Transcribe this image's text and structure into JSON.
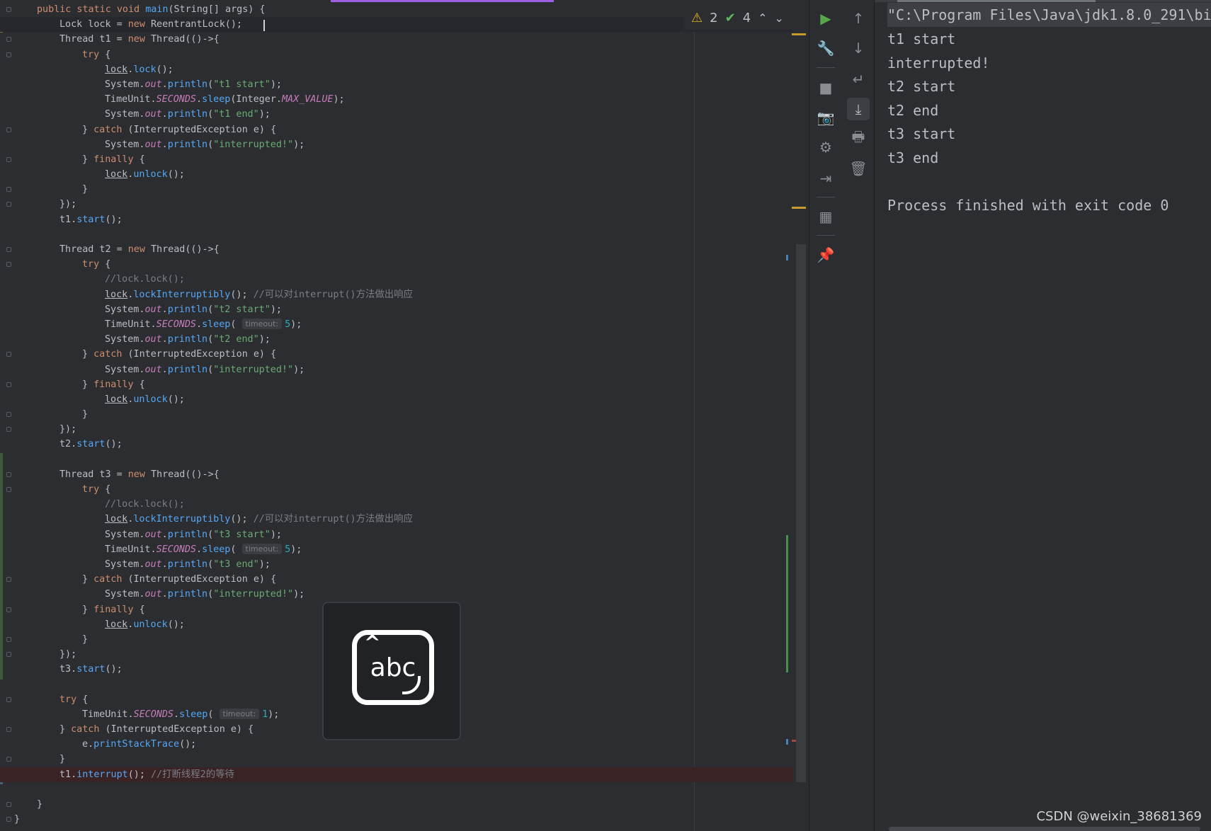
{
  "editor": {
    "lines": [
      {
        "indent": 1,
        "tokens": [
          [
            "kw",
            "public static void "
          ],
          [
            "fn",
            "main"
          ],
          [
            "p",
            "(String[] args) {"
          ]
        ]
      },
      {
        "indent": 2,
        "current": true,
        "tokens": [
          [
            "p",
            "Lock lock = "
          ],
          [
            "kw",
            "new "
          ],
          [
            "p",
            "ReentrantLock();"
          ]
        ]
      },
      {
        "indent": 2,
        "tokens": [
          [
            "p",
            "Thread t1 = "
          ],
          [
            "kw",
            "new "
          ],
          [
            "p",
            "Thread(()->{"
          ]
        ]
      },
      {
        "indent": 3,
        "tokens": [
          [
            "kw",
            "try "
          ],
          [
            "p",
            "{"
          ]
        ]
      },
      {
        "indent": 4,
        "tokens": [
          [
            "local",
            "lock"
          ],
          [
            "p",
            "."
          ],
          [
            "fn",
            "lock"
          ],
          [
            "p",
            "();"
          ]
        ]
      },
      {
        "indent": 4,
        "tokens": [
          [
            "p",
            "System."
          ],
          [
            "fld",
            "out"
          ],
          [
            "p",
            "."
          ],
          [
            "fn",
            "println"
          ],
          [
            "p",
            "("
          ],
          [
            "str",
            "\"t1 start\""
          ],
          [
            "p",
            ");"
          ]
        ]
      },
      {
        "indent": 4,
        "tokens": [
          [
            "p",
            "TimeUnit."
          ],
          [
            "const",
            "SECONDS"
          ],
          [
            "p",
            "."
          ],
          [
            "fn",
            "sleep"
          ],
          [
            "p",
            "(Integer."
          ],
          [
            "const",
            "MAX_VALUE"
          ],
          [
            "p",
            ");"
          ]
        ]
      },
      {
        "indent": 4,
        "tokens": [
          [
            "p",
            "System."
          ],
          [
            "fld",
            "out"
          ],
          [
            "p",
            "."
          ],
          [
            "fn",
            "println"
          ],
          [
            "p",
            "("
          ],
          [
            "str",
            "\"t1 end\""
          ],
          [
            "p",
            ");"
          ]
        ]
      },
      {
        "indent": 3,
        "tokens": [
          [
            "p",
            "} "
          ],
          [
            "kw",
            "catch "
          ],
          [
            "p",
            "(InterruptedException e) {"
          ]
        ]
      },
      {
        "indent": 4,
        "tokens": [
          [
            "p",
            "System."
          ],
          [
            "fld",
            "out"
          ],
          [
            "p",
            "."
          ],
          [
            "fn",
            "println"
          ],
          [
            "p",
            "("
          ],
          [
            "str",
            "\"interrupted!\""
          ],
          [
            "p",
            ");"
          ]
        ]
      },
      {
        "indent": 3,
        "tokens": [
          [
            "p",
            "} "
          ],
          [
            "kw",
            "finally "
          ],
          [
            "p",
            "{"
          ]
        ]
      },
      {
        "indent": 4,
        "tokens": [
          [
            "local",
            "lock"
          ],
          [
            "p",
            "."
          ],
          [
            "fn",
            "unlock"
          ],
          [
            "p",
            "();"
          ]
        ]
      },
      {
        "indent": 3,
        "tokens": [
          [
            "p",
            "}"
          ]
        ]
      },
      {
        "indent": 2,
        "tokens": [
          [
            "p",
            "});"
          ]
        ]
      },
      {
        "indent": 2,
        "tokens": [
          [
            "p",
            "t1."
          ],
          [
            "fn",
            "start"
          ],
          [
            "p",
            "();"
          ]
        ]
      },
      {
        "indent": 0,
        "tokens": []
      },
      {
        "indent": 2,
        "tokens": [
          [
            "p",
            "Thread t2 = "
          ],
          [
            "kw",
            "new "
          ],
          [
            "p",
            "Thread(()->{"
          ]
        ]
      },
      {
        "indent": 3,
        "tokens": [
          [
            "kw",
            "try "
          ],
          [
            "p",
            "{"
          ]
        ]
      },
      {
        "indent": 4,
        "tokens": [
          [
            "cmt",
            "//lock.lock();"
          ]
        ]
      },
      {
        "indent": 4,
        "tokens": [
          [
            "local",
            "lock"
          ],
          [
            "p",
            "."
          ],
          [
            "fn",
            "lockInterruptibly"
          ],
          [
            "p",
            "(); "
          ],
          [
            "cmt",
            "//可以对interrupt()方法做出响应"
          ]
        ]
      },
      {
        "indent": 4,
        "tokens": [
          [
            "p",
            "System."
          ],
          [
            "fld",
            "out"
          ],
          [
            "p",
            "."
          ],
          [
            "fn",
            "println"
          ],
          [
            "p",
            "("
          ],
          [
            "str",
            "\"t2 start\""
          ],
          [
            "p",
            ");"
          ]
        ]
      },
      {
        "indent": 4,
        "tokens": [
          [
            "p",
            "TimeUnit."
          ],
          [
            "const",
            "SECONDS"
          ],
          [
            "p",
            "."
          ],
          [
            "fn",
            "sleep"
          ],
          [
            "p",
            "( "
          ],
          [
            "hint",
            "timeout:"
          ],
          [
            "num",
            "5"
          ],
          [
            "p",
            ");"
          ]
        ]
      },
      {
        "indent": 4,
        "tokens": [
          [
            "p",
            "System."
          ],
          [
            "fld",
            "out"
          ],
          [
            "p",
            "."
          ],
          [
            "fn",
            "println"
          ],
          [
            "p",
            "("
          ],
          [
            "str",
            "\"t2 end\""
          ],
          [
            "p",
            ");"
          ]
        ]
      },
      {
        "indent": 3,
        "tokens": [
          [
            "p",
            "} "
          ],
          [
            "kw",
            "catch "
          ],
          [
            "p",
            "(InterruptedException e) {"
          ]
        ]
      },
      {
        "indent": 4,
        "tokens": [
          [
            "p",
            "System."
          ],
          [
            "fld",
            "out"
          ],
          [
            "p",
            "."
          ],
          [
            "fn",
            "println"
          ],
          [
            "p",
            "("
          ],
          [
            "str",
            "\"interrupted!\""
          ],
          [
            "p",
            ");"
          ]
        ]
      },
      {
        "indent": 3,
        "tokens": [
          [
            "p",
            "} "
          ],
          [
            "kw",
            "finally "
          ],
          [
            "p",
            "{"
          ]
        ]
      },
      {
        "indent": 4,
        "tokens": [
          [
            "local",
            "lock"
          ],
          [
            "p",
            "."
          ],
          [
            "fn",
            "unlock"
          ],
          [
            "p",
            "();"
          ]
        ]
      },
      {
        "indent": 3,
        "tokens": [
          [
            "p",
            "}"
          ]
        ]
      },
      {
        "indent": 2,
        "tokens": [
          [
            "p",
            "});"
          ]
        ]
      },
      {
        "indent": 2,
        "tokens": [
          [
            "p",
            "t2."
          ],
          [
            "fn",
            "start"
          ],
          [
            "p",
            "();"
          ]
        ]
      },
      {
        "indent": 0,
        "tokens": []
      },
      {
        "indent": 2,
        "tokens": [
          [
            "p",
            "Thread t3 = "
          ],
          [
            "kw",
            "new "
          ],
          [
            "p",
            "Thread(()->{"
          ]
        ]
      },
      {
        "indent": 3,
        "tokens": [
          [
            "kw",
            "try "
          ],
          [
            "p",
            "{"
          ]
        ]
      },
      {
        "indent": 4,
        "tokens": [
          [
            "cmt",
            "//lock.lock();"
          ]
        ]
      },
      {
        "indent": 4,
        "tokens": [
          [
            "local",
            "lock"
          ],
          [
            "p",
            "."
          ],
          [
            "fn",
            "lockInterruptibly"
          ],
          [
            "p",
            "(); "
          ],
          [
            "cmt",
            "//可以对interrupt()方法做出响应"
          ]
        ]
      },
      {
        "indent": 4,
        "tokens": [
          [
            "p",
            "System."
          ],
          [
            "fld",
            "out"
          ],
          [
            "p",
            "."
          ],
          [
            "fn",
            "println"
          ],
          [
            "p",
            "("
          ],
          [
            "str",
            "\"t3 start\""
          ],
          [
            "p",
            ");"
          ]
        ]
      },
      {
        "indent": 4,
        "tokens": [
          [
            "p",
            "TimeUnit."
          ],
          [
            "const",
            "SECONDS"
          ],
          [
            "p",
            "."
          ],
          [
            "fn",
            "sleep"
          ],
          [
            "p",
            "( "
          ],
          [
            "hint",
            "timeout:"
          ],
          [
            "num",
            "5"
          ],
          [
            "p",
            ");"
          ]
        ]
      },
      {
        "indent": 4,
        "tokens": [
          [
            "p",
            "System."
          ],
          [
            "fld",
            "out"
          ],
          [
            "p",
            "."
          ],
          [
            "fn",
            "println"
          ],
          [
            "p",
            "("
          ],
          [
            "str",
            "\"t3 end\""
          ],
          [
            "p",
            ");"
          ]
        ]
      },
      {
        "indent": 3,
        "tokens": [
          [
            "p",
            "} "
          ],
          [
            "kw",
            "catch "
          ],
          [
            "p",
            "(InterruptedException e) {"
          ]
        ]
      },
      {
        "indent": 4,
        "tokens": [
          [
            "p",
            "System."
          ],
          [
            "fld",
            "out"
          ],
          [
            "p",
            "."
          ],
          [
            "fn",
            "println"
          ],
          [
            "p",
            "("
          ],
          [
            "str",
            "\"interrupted!\""
          ],
          [
            "p",
            ");"
          ]
        ]
      },
      {
        "indent": 3,
        "tokens": [
          [
            "p",
            "} "
          ],
          [
            "kw",
            "finally "
          ],
          [
            "p",
            "{"
          ]
        ]
      },
      {
        "indent": 4,
        "tokens": [
          [
            "local",
            "lock"
          ],
          [
            "p",
            "."
          ],
          [
            "fn",
            "unlock"
          ],
          [
            "p",
            "();"
          ]
        ]
      },
      {
        "indent": 3,
        "tokens": [
          [
            "p",
            "}"
          ]
        ]
      },
      {
        "indent": 2,
        "tokens": [
          [
            "p",
            "});"
          ]
        ]
      },
      {
        "indent": 2,
        "tokens": [
          [
            "p",
            "t3."
          ],
          [
            "fn",
            "start"
          ],
          [
            "p",
            "();"
          ]
        ]
      },
      {
        "indent": 0,
        "tokens": []
      },
      {
        "indent": 2,
        "tokens": [
          [
            "kw",
            "try "
          ],
          [
            "p",
            "{"
          ]
        ]
      },
      {
        "indent": 3,
        "tokens": [
          [
            "p",
            "TimeUnit."
          ],
          [
            "const",
            "SECONDS"
          ],
          [
            "p",
            "."
          ],
          [
            "fn",
            "sleep"
          ],
          [
            "p",
            "( "
          ],
          [
            "hint",
            "timeout:"
          ],
          [
            "num",
            "1"
          ],
          [
            "p",
            ");"
          ]
        ]
      },
      {
        "indent": 2,
        "tokens": [
          [
            "p",
            "} "
          ],
          [
            "kw",
            "catch "
          ],
          [
            "p",
            "(InterruptedException e) {"
          ]
        ]
      },
      {
        "indent": 3,
        "tokens": [
          [
            "p",
            "e."
          ],
          [
            "fn",
            "printStackTrace"
          ],
          [
            "p",
            "();"
          ]
        ]
      },
      {
        "indent": 2,
        "tokens": [
          [
            "p",
            "}"
          ]
        ]
      },
      {
        "indent": 2,
        "error": true,
        "tokens": [
          [
            "p",
            "t1."
          ],
          [
            "fn",
            "interrupt"
          ],
          [
            "p",
            "(); "
          ],
          [
            "cmt",
            "//打断线程2的等待"
          ]
        ]
      },
      {
        "indent": 0,
        "tokens": []
      },
      {
        "indent": 1,
        "tokens": [
          [
            "p",
            "}"
          ]
        ]
      },
      {
        "indent": 0,
        "tokens": [
          [
            "p",
            "}"
          ]
        ]
      }
    ],
    "inspections": {
      "warnings": "2",
      "ok": "4",
      "warn_icon": "⚠",
      "ok_icon": "✔",
      "prev_icon": "⌃",
      "next_icon": "⌄"
    }
  },
  "floating_icon": {
    "label": "abc",
    "caret": "^"
  },
  "toolbar": {
    "col1": [
      "▶",
      "🔧",
      "■",
      "📷",
      "⚙",
      "⇥",
      "▦",
      "📌"
    ],
    "col2": [
      "↑",
      "↓",
      "↵",
      "⤓",
      "🖶",
      "🗑"
    ]
  },
  "console": {
    "lines": [
      "\"C:\\Program Files\\Java\\jdk1.8.0_291\\bi",
      "t1 start",
      "interrupted!",
      "t2 start",
      "t2 end",
      "t3 start",
      "t3 end",
      "",
      "Process finished with exit code 0"
    ]
  },
  "watermark": "CSDN @weixin_38681369",
  "colors": {
    "keyword": "#cf8e6d",
    "string": "#6aab73",
    "comment": "#7a7e85",
    "field": "#c77dbb",
    "accent": "#9c5fe0"
  }
}
